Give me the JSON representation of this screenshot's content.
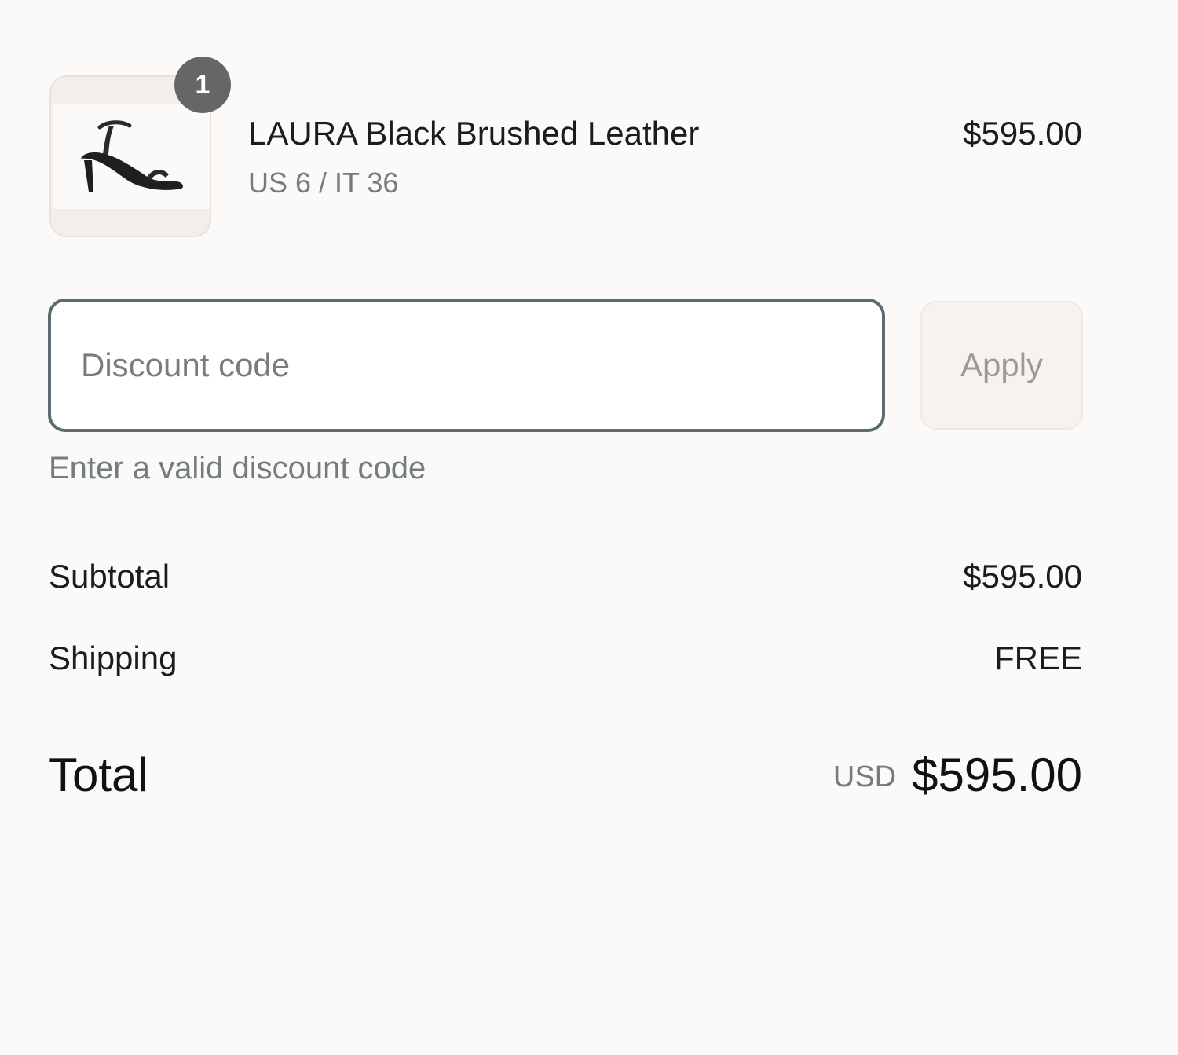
{
  "product": {
    "name": "LAURA Black Brushed Leather",
    "variant": "US 6 / IT 36",
    "price": "$595.00",
    "quantity": "1",
    "image_icon": "sandal-image"
  },
  "discount": {
    "placeholder": "Discount code",
    "value": "",
    "apply_label": "Apply",
    "error": "Enter a valid discount code"
  },
  "totals": {
    "subtotal_label": "Subtotal",
    "subtotal_value": "$595.00",
    "shipping_label": "Shipping",
    "shipping_value": "FREE",
    "total_label": "Total",
    "currency": "USD",
    "total_value": "$595.00"
  },
  "colors": {
    "background": "#fbfaf8",
    "input_border": "#5d6b70",
    "badge": "#666666",
    "error_text": "#737c7e"
  }
}
